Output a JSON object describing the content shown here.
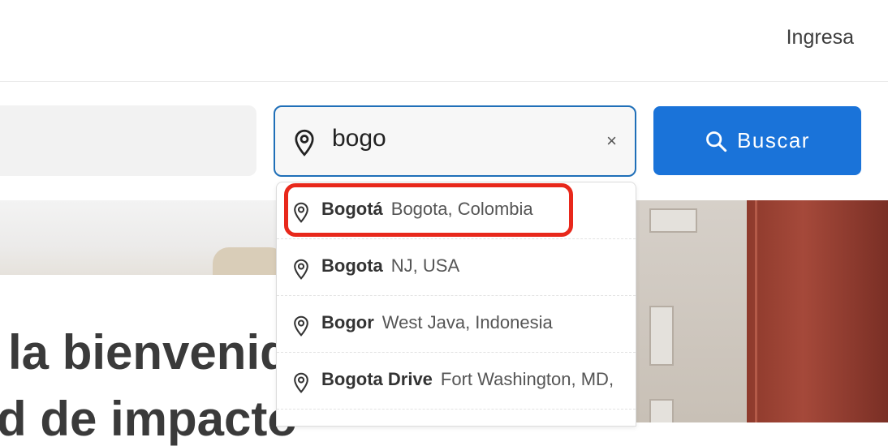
{
  "header": {
    "login_label": "Ingresa"
  },
  "search": {
    "location_value": "bogo",
    "clear_symbol": "×",
    "button_label": "Buscar"
  },
  "suggestions": [
    {
      "name": "Bogotá",
      "region": "Bogota, Colombia"
    },
    {
      "name": "Bogota",
      "region": "NJ, USA"
    },
    {
      "name": "Bogor",
      "region": "West Java, Indonesia"
    },
    {
      "name": "Bogota Drive",
      "region": "Fort Washington, MD,"
    }
  ],
  "hero": {
    "title_line1": "la bienvenid",
    "title_line2": "d de impacto"
  },
  "colors": {
    "accent": "#1a73d9",
    "focus_border": "#1f6fb8",
    "highlight": "#e8281b"
  },
  "icons": {
    "location": "map-pin-icon",
    "search": "magnifier-icon",
    "clear": "close-icon"
  }
}
